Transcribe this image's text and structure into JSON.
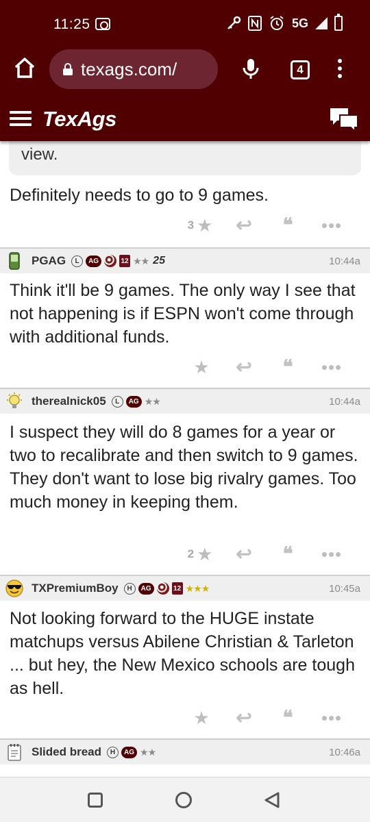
{
  "status_bar": {
    "time": "11:25",
    "network": "5G",
    "icons": [
      "screen-record-icon",
      "key-icon",
      "nfc-icon",
      "alarm-icon",
      "signal-icon",
      "battery-charging-icon"
    ]
  },
  "browser": {
    "url": "texags.com/",
    "tab_count": "4"
  },
  "site": {
    "logo": "TexAgs",
    "brand_color": "#500000"
  },
  "quote_fragment": "view.",
  "posts": [
    {
      "body": "Definitely needs to go to 9 games.",
      "star_count": "3"
    },
    {
      "username": "PGAG",
      "avatar": "phone-avatar-icon",
      "badges": [
        "L",
        "AG"
      ],
      "badge_12": "12",
      "stars": "★★",
      "rank": "25",
      "time": "10:44a",
      "body": "Think it'll be 9 games. The only way I see that not happening is if ESPN won't come through with additional funds.",
      "star_count": ""
    },
    {
      "username": "therealnick05",
      "avatar": "lightbulb-avatar-icon",
      "badges": [
        "L",
        "AG"
      ],
      "stars": "★★",
      "time": "10:44a",
      "body": "I suspect they will do 8 games for a year or two to recalibrate and then switch to 9 games. They don't want to lose big rivalry games. Too much money in keeping them.",
      "star_count": "2"
    },
    {
      "username": "TXPremiumBoy",
      "avatar": "sunglasses-smiley-avatar-icon",
      "badges": [
        "H",
        "AG"
      ],
      "badge_12": "12",
      "stars": "★★★",
      "time": "10:45a",
      "body": "Not looking forward to the HUGE instate matchups versus Abilene Christian & Tarleton ... but hey, the New Mexico schools are tough as hell.",
      "star_count": ""
    },
    {
      "username": "Slided bread",
      "avatar": "notepad-avatar-icon",
      "badges": [
        "H",
        "AG"
      ],
      "stars": "★★",
      "time": "10:46a"
    }
  ],
  "action_glyphs": {
    "star": "★",
    "reply": "↩",
    "quote": "❝",
    "more": "•••"
  }
}
